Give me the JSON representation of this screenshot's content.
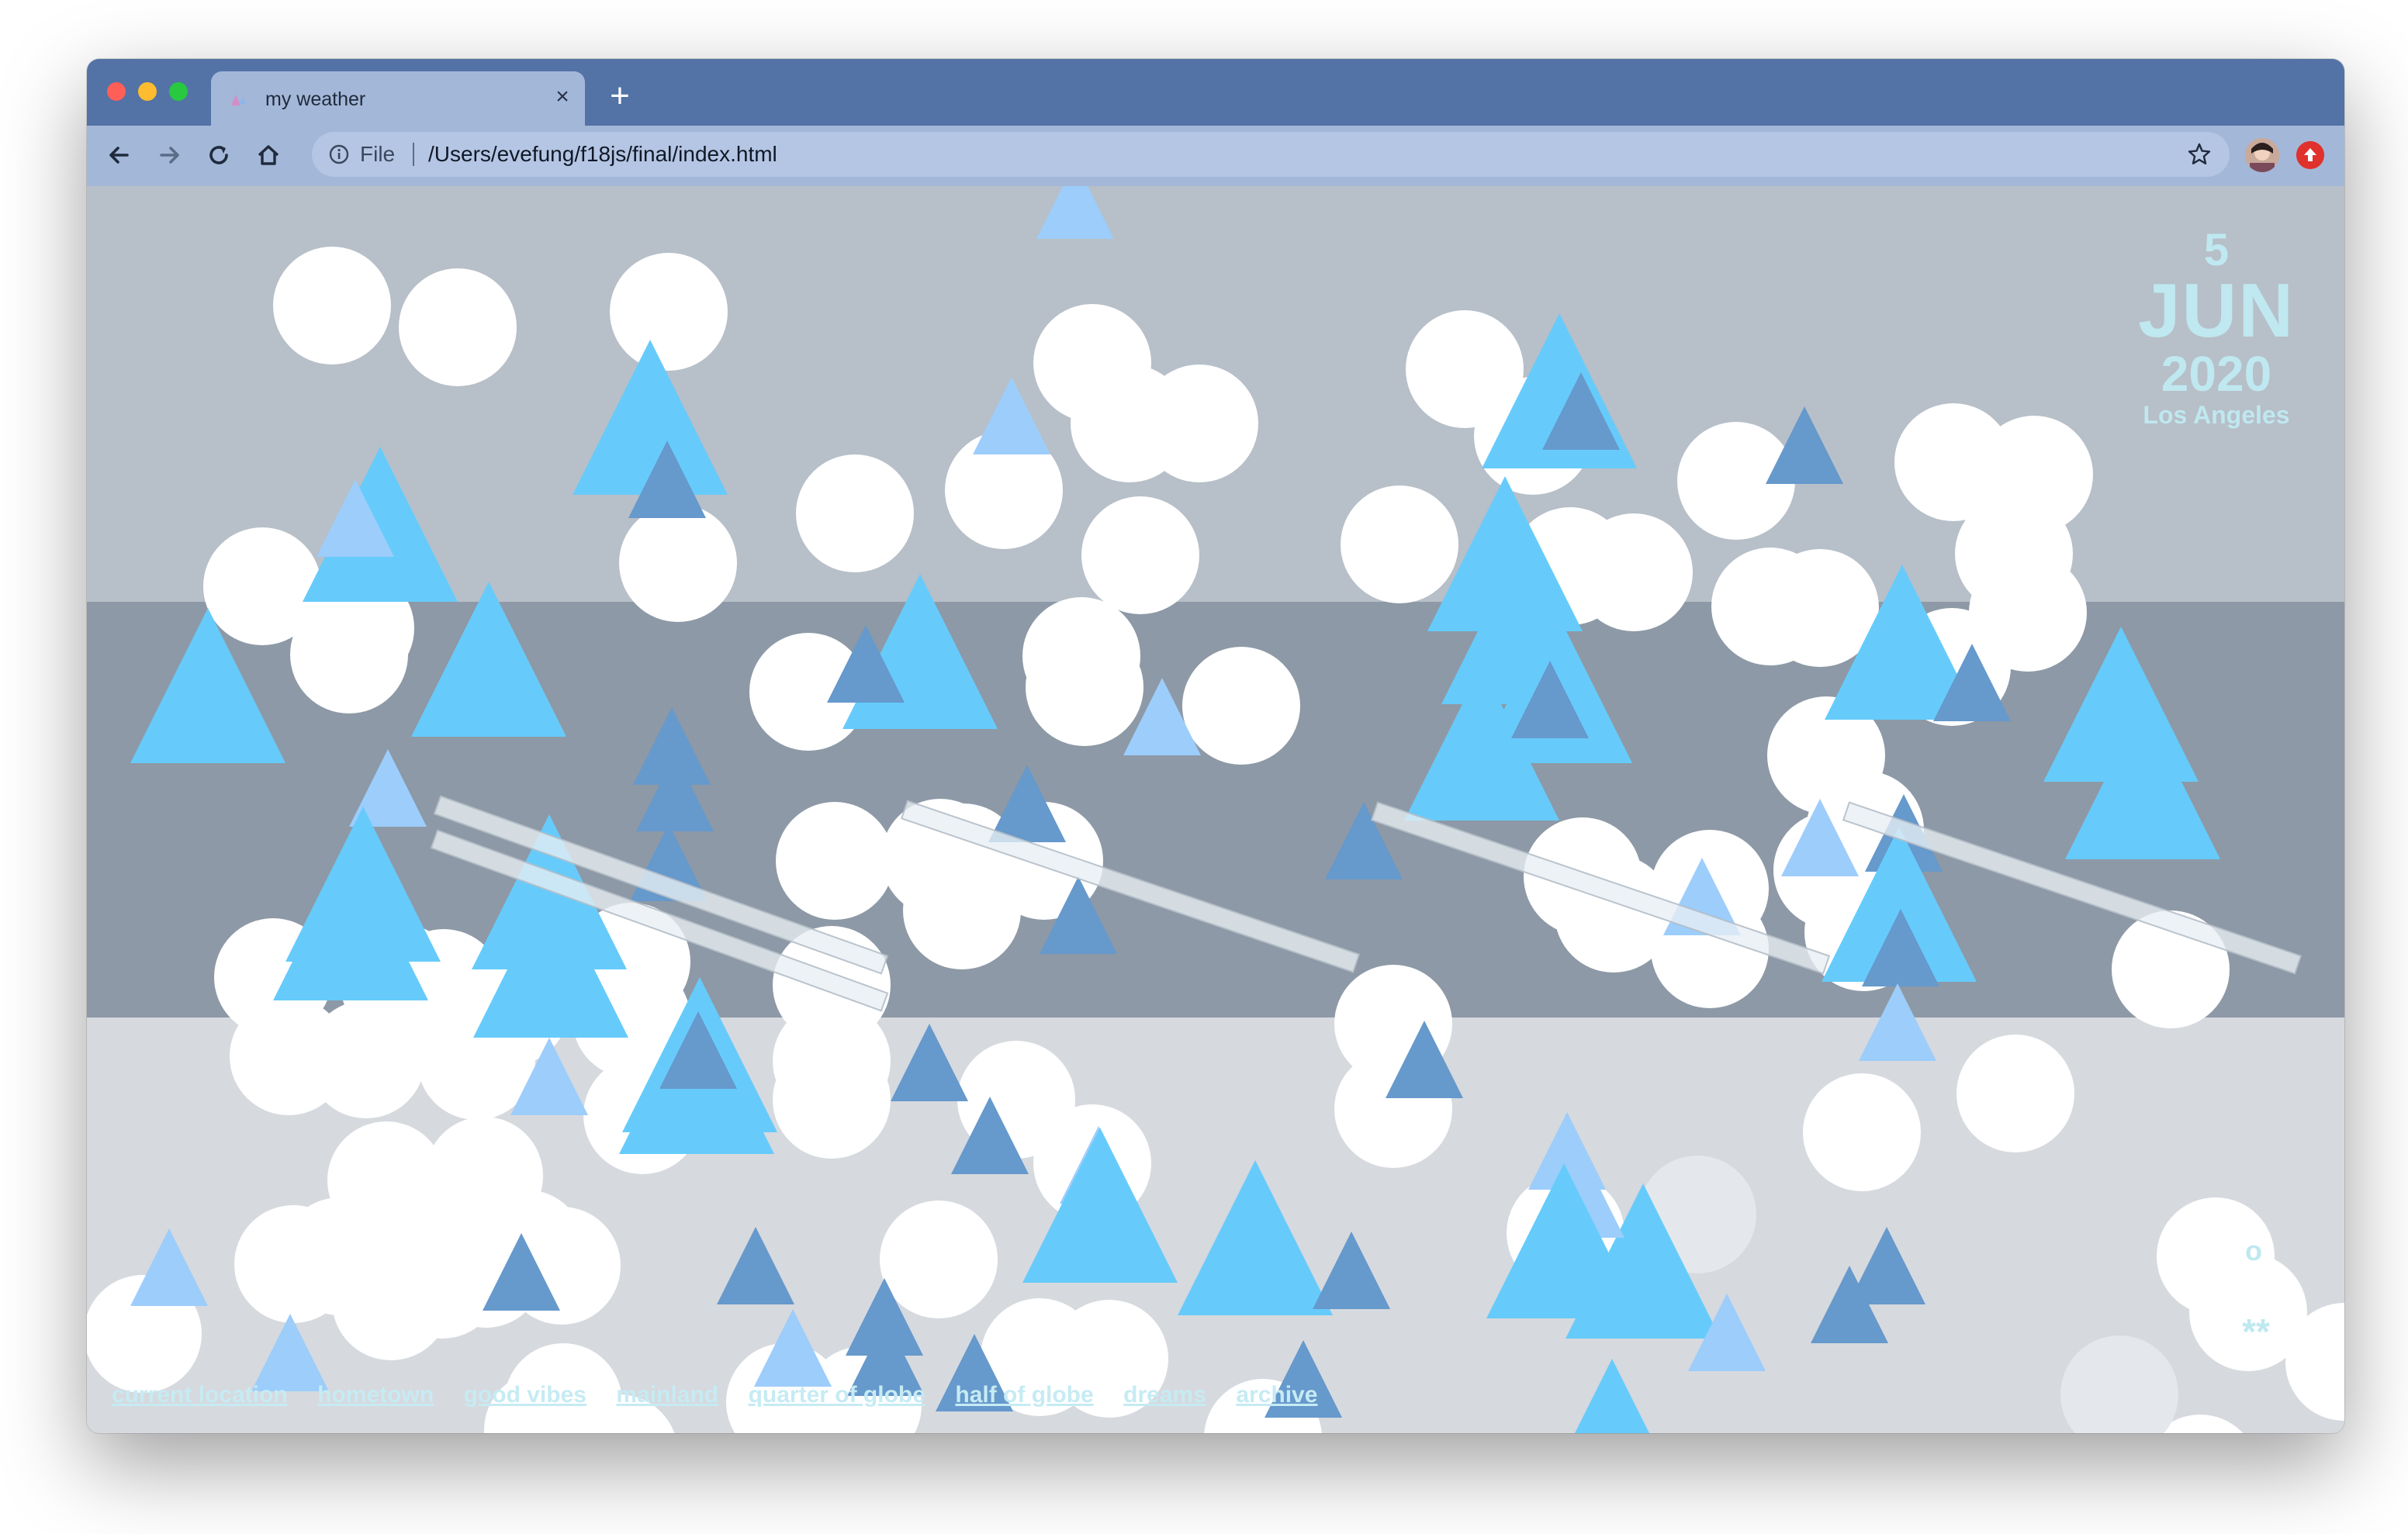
{
  "browser": {
    "tab_title": "my weather",
    "file_label": "File",
    "url": "/Users/evefung/f18js/final/index.html",
    "accent_color": "#5372a6"
  },
  "weather": {
    "day": "5",
    "month": "JUN",
    "year": "2020",
    "city": "Los Angeles",
    "symbol_degree": "o",
    "symbol_snow": "**"
  },
  "nav_links": [
    "current location",
    "hometown",
    "good vibes",
    "mainland",
    "quarter of globe",
    "half of globe",
    "dreams",
    "archive"
  ],
  "colors": {
    "band_top": "#b7bfc8",
    "band_mid": "#8d99a6",
    "band_bottom": "#d6d9de",
    "circle": "#ffffff",
    "triangle_light": "#66cbfb",
    "triangle_pale": "#9ccdfb",
    "triangle_dark": "#6699cc",
    "text_cyan": "#bfe8f0"
  }
}
